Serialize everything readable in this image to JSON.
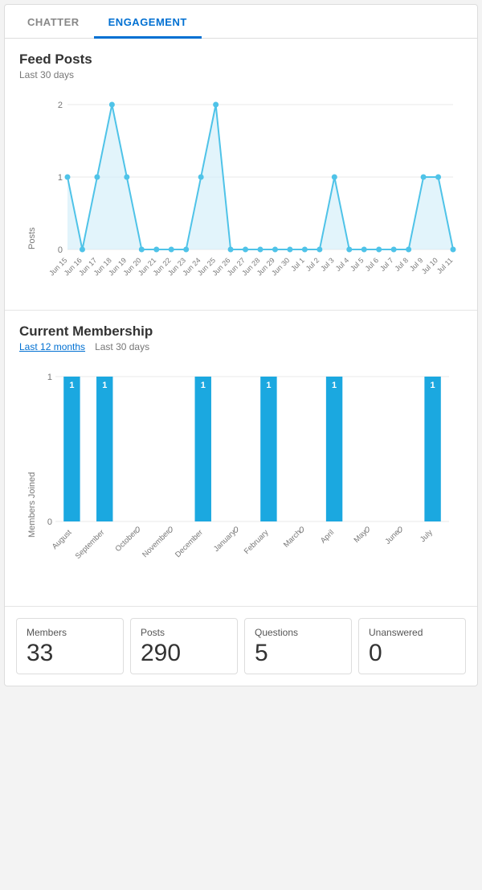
{
  "tabs": [
    {
      "id": "chatter",
      "label": "CHATTER",
      "active": false
    },
    {
      "id": "engagement",
      "label": "ENGAGEMENT",
      "active": true
    }
  ],
  "feedPosts": {
    "title": "Feed Posts",
    "subtitle": "Last 30 days",
    "yAxisLabel": "Posts",
    "yMax": 2,
    "yMid": 1,
    "yMin": 0,
    "xLabels": [
      "Jun 15",
      "Jun 16",
      "Jun 17",
      "Jun 18",
      "Jun 19",
      "Jun 20",
      "Jun 21",
      "Jun 22",
      "Jun 23",
      "Jun 24",
      "Jun 25",
      "Jun 26",
      "Jun 27",
      "Jun 28",
      "Jun 29",
      "Jun 30",
      "Jul 1",
      "Jul 2",
      "Jul 3",
      "Jul 4",
      "Jul 5",
      "Jul 6",
      "Jul 7",
      "Jul 8",
      "Jul 9",
      "Jul 10",
      "Jul 11"
    ],
    "dataPoints": [
      1,
      0,
      1,
      2,
      1,
      0,
      0,
      0,
      0,
      1,
      2,
      0,
      0,
      0,
      0,
      0,
      0,
      0,
      1,
      0,
      0,
      0,
      0,
      0,
      1,
      1,
      0
    ]
  },
  "currentMembership": {
    "title": "Current Membership",
    "yAxisLabel": "Members Joined",
    "filters": [
      {
        "label": "Last 12 months",
        "active": true
      },
      {
        "label": "Last 30 days",
        "active": false
      }
    ],
    "xLabels": [
      "August",
      "September",
      "October",
      "November",
      "December",
      "January",
      "February",
      "March",
      "April",
      "May",
      "June",
      "July"
    ],
    "dataPoints": [
      1,
      1,
      0,
      0,
      1,
      0,
      1,
      0,
      1,
      0,
      0,
      1
    ],
    "yMax": 1,
    "yMin": 0
  },
  "stats": [
    {
      "label": "Members",
      "value": "33"
    },
    {
      "label": "Posts",
      "value": "290"
    },
    {
      "label": "Questions",
      "value": "5"
    },
    {
      "label": "Unanswered",
      "value": "0"
    }
  ],
  "colors": {
    "accent": "#0070d2",
    "lineColor": "#4fc3e8",
    "areaFill": "#d6f0fa",
    "barColor": "#1ba8e0",
    "gridLine": "#e8e8e8"
  }
}
